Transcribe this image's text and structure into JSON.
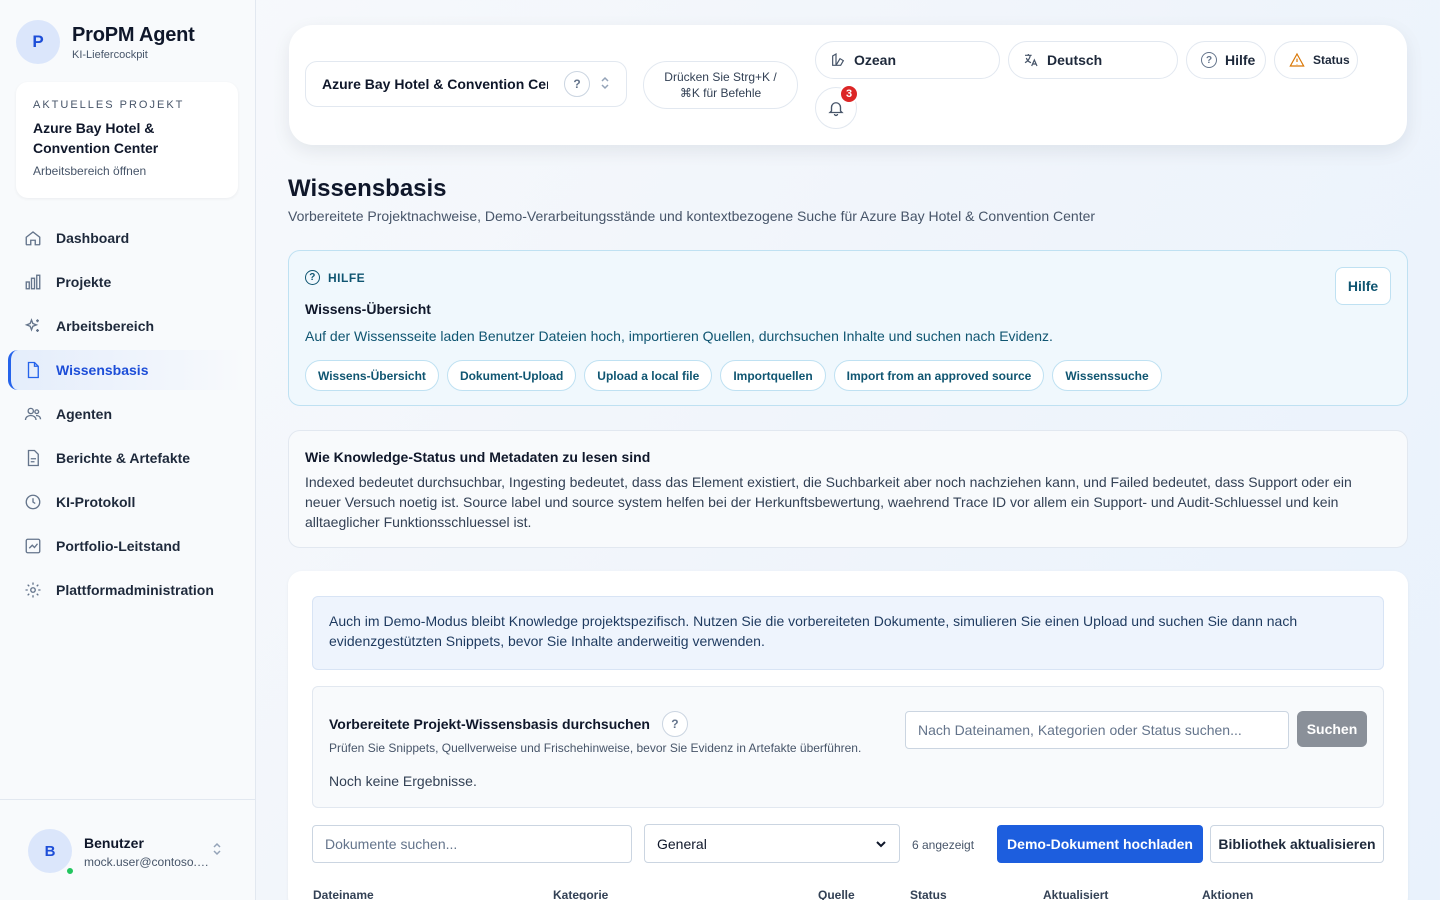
{
  "brand": {
    "logo_letter": "P",
    "title": "ProPM Agent",
    "subtitle": "KI-Liefercockpit"
  },
  "current_project": {
    "eyebrow": "AKTUELLES PROJEKT",
    "name": "Azure Bay Hotel & Convention Center",
    "link": "Arbeitsbereich öffnen"
  },
  "nav": {
    "items": [
      {
        "label": "Dashboard",
        "icon": "home-icon",
        "active": false
      },
      {
        "label": "Projekte",
        "icon": "bar-chart-icon",
        "active": false
      },
      {
        "label": "Arbeitsbereich",
        "icon": "sparkles-icon",
        "active": false
      },
      {
        "label": "Wissensbasis",
        "icon": "document-icon",
        "active": true
      },
      {
        "label": "Agenten",
        "icon": "users-icon",
        "active": false
      },
      {
        "label": "Berichte & Artefakte",
        "icon": "file-text-icon",
        "active": false
      },
      {
        "label": "KI-Protokoll",
        "icon": "clock-icon",
        "active": false
      },
      {
        "label": "Portfolio-Leitstand",
        "icon": "line-chart-icon",
        "active": false
      },
      {
        "label": "Plattformadministration",
        "icon": "gear-icon",
        "active": false
      }
    ]
  },
  "user": {
    "initial": "B",
    "name": "Benutzer",
    "email": "mock.user@contoso.com"
  },
  "topbar": {
    "project_select": "Azure Bay Hotel & Convention Center",
    "command_hint": "Drücken Sie Strg+K / ⌘K für Befehle",
    "theme": "Ozean",
    "language": "Deutsch",
    "help": "Hilfe",
    "status": "Status",
    "notifications_count": "3"
  },
  "page": {
    "title": "Wissensbasis",
    "subtitle": "Vorbereitete Projektnachweise, Demo-Verarbeitungsstände und kontextbezogene Suche für Azure Bay Hotel & Convention Center"
  },
  "help_card": {
    "eyebrow": "HILFE",
    "title": "Wissens-Übersicht",
    "text": "Auf der Wissensseite laden Benutzer Dateien hoch, importieren Quellen, durchsuchen Inhalte und suchen nach Evidenz.",
    "button": "Hilfe",
    "chips": [
      "Wissens-Übersicht",
      "Dokument-Upload",
      "Upload a local file",
      "Importquellen",
      "Import from an approved source",
      "Wissenssuche"
    ]
  },
  "info_card": {
    "title": "Wie Knowledge-Status und Metadaten zu lesen sind",
    "text": "Indexed bedeutet durchsuchbar, Ingesting bedeutet, dass das Element existiert, die Suchbarkeit aber noch nachziehen kann, und Failed bedeutet, dass Support oder ein neuer Versuch noetig ist. Source label und source system helfen bei der Herkunftsbewertung, waehrend Trace ID vor allem ein Support- und Audit-Schluessel und kein alltaeglicher Funktionsschluessel ist."
  },
  "demo_banner": "Auch im Demo-Modus bleibt Knowledge projektspezifisch. Nutzen Sie die vorbereiteten Dokumente, simulieren Sie einen Upload und suchen Sie dann nach evidenzgestützten Snippets, bevor Sie Inhalte anderweitig verwenden.",
  "kb_search": {
    "title": "Vorbereitete Projekt-Wissensbasis durchsuchen",
    "hint": "Prüfen Sie Snippets, Quellverweise und Frischehinweise, bevor Sie Evidenz in Artefakte überführen.",
    "empty": "Noch keine Ergebnisse.",
    "placeholder": "Nach Dateinamen, Kategorien oder Status suchen...",
    "button": "Suchen"
  },
  "doc_toolbar": {
    "search_placeholder": "Dokumente suchen...",
    "category": "General",
    "count": "6 angezeigt",
    "upload": "Demo-Dokument hochladen",
    "refresh": "Bibliothek aktualisieren"
  },
  "table": {
    "columns": [
      "Dateiname",
      "Kategorie",
      "Quelle",
      "Status",
      "Aktualisiert",
      "Aktionen"
    ]
  },
  "colors": {
    "accent": "#1d5ede",
    "badge": "#dc2626",
    "online": "#22c55e",
    "help_bg": "#f0f8fd"
  }
}
